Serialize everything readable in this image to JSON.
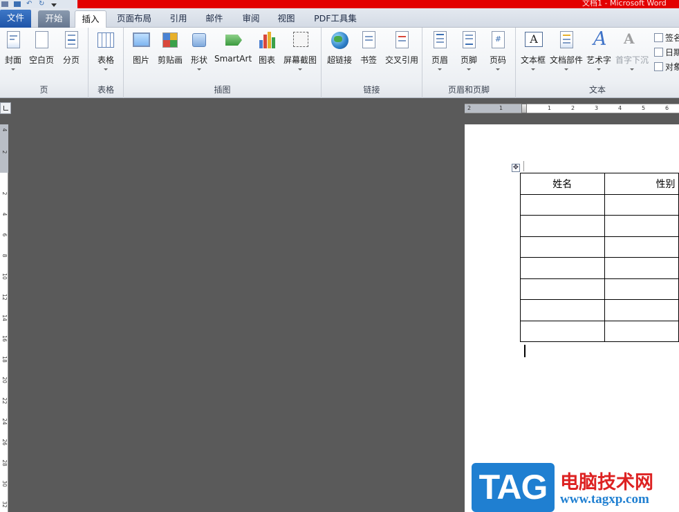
{
  "window": {
    "title": "文档1 - Microsoft Word"
  },
  "tabs": [
    {
      "label": "文件"
    },
    {
      "label": "开始"
    },
    {
      "label": "插入"
    },
    {
      "label": "页面布局"
    },
    {
      "label": "引用"
    },
    {
      "label": "邮件"
    },
    {
      "label": "审阅"
    },
    {
      "label": "视图"
    },
    {
      "label": "PDF工具集"
    }
  ],
  "ribbon": {
    "groups": {
      "pages": "页",
      "tables": "表格",
      "illustrations": "插图",
      "links": "链接",
      "header_footer": "页眉和页脚",
      "text": "文本"
    },
    "buttons": {
      "cover": "封面",
      "blank_page": "空白页",
      "page_break": "分页",
      "table": "表格",
      "picture": "图片",
      "clip_art": "剪贴画",
      "shapes": "形状",
      "smartart": "SmartArt",
      "chart": "图表",
      "screenshot": "屏幕截图",
      "hyperlink": "超链接",
      "bookmark": "书签",
      "cross_reference": "交叉引用",
      "header": "页眉",
      "footer": "页脚",
      "page_number": "页码",
      "text_box": "文本框",
      "quick_parts": "文档部件",
      "wordart": "艺术字",
      "drop_cap": "首字下沉",
      "signature": "签名行",
      "date_time": "日期和时间",
      "object": "对象"
    }
  },
  "ruler": {
    "horizontal": [
      "2",
      "1",
      "1",
      "2",
      "3",
      "4",
      "5",
      "6"
    ],
    "vertical": [
      "4",
      "2",
      "2",
      "4",
      "6",
      "8",
      "10",
      "12",
      "14",
      "16",
      "18",
      "20",
      "22",
      "24",
      "26",
      "28",
      "30",
      "32"
    ]
  },
  "document": {
    "table": {
      "headers": [
        "姓名",
        "性别"
      ],
      "rows": 7
    }
  },
  "watermark": {
    "logo": "TAG",
    "site_name": "电脑技术网",
    "url": "www.tagxp.com"
  }
}
